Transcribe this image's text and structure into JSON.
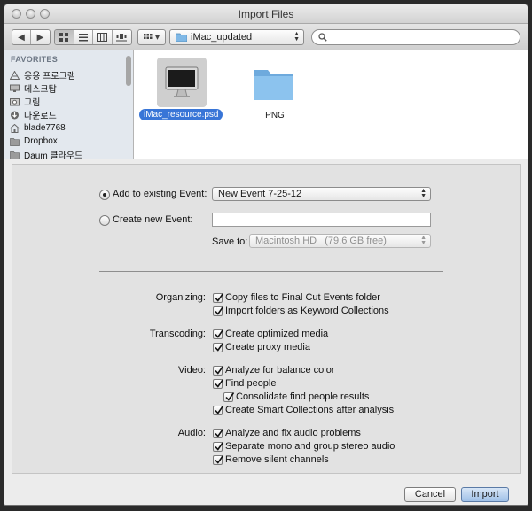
{
  "window": {
    "title": "Import Files"
  },
  "toolbar": {
    "back_label": "◀",
    "forward_label": "▶",
    "view_modes": [
      "icon",
      "list",
      "column",
      "coverflow"
    ],
    "arrange_label": "▾",
    "location": "iMac_updated",
    "search_placeholder": ""
  },
  "sidebar": {
    "header": "FAVORITES",
    "items": [
      {
        "label": "응용 프로그램",
        "icon": "applications-icon"
      },
      {
        "label": "데스크탑",
        "icon": "desktop-icon"
      },
      {
        "label": "그림",
        "icon": "pictures-icon"
      },
      {
        "label": "다운로드",
        "icon": "downloads-icon"
      },
      {
        "label": "blade7768",
        "icon": "home-icon"
      },
      {
        "label": "Dropbox",
        "icon": "folder-icon"
      },
      {
        "label": "Daum 클라우드",
        "icon": "folder-icon"
      }
    ]
  },
  "files": [
    {
      "name": "iMac_resource.psd",
      "icon": "imac-icon",
      "selected": true
    },
    {
      "name": "PNG",
      "icon": "folder-icon",
      "selected": false
    }
  ],
  "event": {
    "add_existing_label": "Add to existing Event:",
    "existing_event_value": "New Event 7-25-12",
    "create_new_label": "Create new Event:",
    "new_event_value": "",
    "save_to_label": "Save to:",
    "save_to_value": "Macintosh HD   (79.6 GB free)",
    "selected_option": "add_existing"
  },
  "options": {
    "organizing": {
      "label": "Organizing:",
      "items": [
        {
          "label": "Copy files to Final Cut Events folder",
          "checked": true
        },
        {
          "label": "Import folders as Keyword Collections",
          "checked": true
        }
      ]
    },
    "transcoding": {
      "label": "Transcoding:",
      "items": [
        {
          "label": "Create optimized media",
          "checked": true
        },
        {
          "label": "Create proxy media",
          "checked": true
        }
      ]
    },
    "video": {
      "label": "Video:",
      "items": [
        {
          "label": "Analyze for balance color",
          "checked": true
        },
        {
          "label": "Find people",
          "checked": true
        },
        {
          "label": "Consolidate find people results",
          "checked": true
        },
        {
          "label": "Create Smart Collections after analysis",
          "checked": true
        }
      ]
    },
    "audio": {
      "label": "Audio:",
      "items": [
        {
          "label": "Analyze and fix audio problems",
          "checked": true
        },
        {
          "label": "Separate mono and group stereo audio",
          "checked": true
        },
        {
          "label": "Remove silent channels",
          "checked": true
        }
      ]
    }
  },
  "buttons": {
    "cancel": "Cancel",
    "import": "Import"
  },
  "colors": {
    "selection": "#3875d7",
    "folder": "#7fb8e6",
    "default_button": "#9fc0e8"
  }
}
